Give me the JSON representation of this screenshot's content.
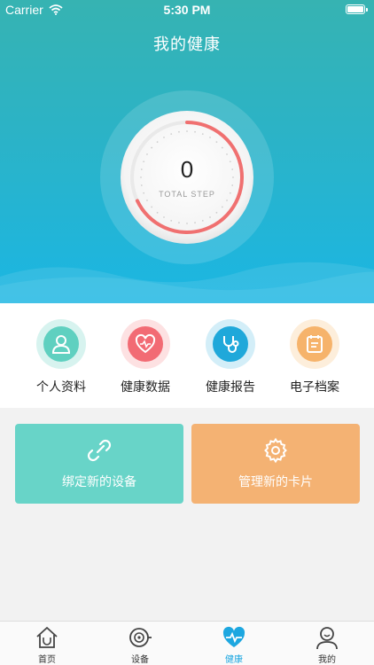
{
  "status_bar": {
    "carrier": "Carrier",
    "time": "5:30 PM"
  },
  "header": {
    "title": "我的健康"
  },
  "step_dial": {
    "value": "0",
    "label": "TOTAL STEP",
    "progress_fraction": 0.68
  },
  "quick_actions": [
    {
      "label": "个人资料",
      "icon": "person-icon",
      "color": "#5fd0c0"
    },
    {
      "label": "健康数据",
      "icon": "heart-data-icon",
      "color": "#f26b74"
    },
    {
      "label": "健康报告",
      "icon": "stethoscope-icon",
      "color": "#1fa8da"
    },
    {
      "label": "电子档案",
      "icon": "file-archive-icon",
      "color": "#f6b36b"
    }
  ],
  "cards": [
    {
      "label": "绑定新的设备",
      "icon": "link-icon",
      "color": "#68d4c8"
    },
    {
      "label": "管理新的卡片",
      "icon": "gear-icon",
      "color": "#f4b273"
    }
  ],
  "tabs": [
    {
      "label": "首页",
      "icon": "home-icon"
    },
    {
      "label": "设备",
      "icon": "device-icon"
    },
    {
      "label": "健康",
      "icon": "heartbeat-icon",
      "active": true
    },
    {
      "label": "我的",
      "icon": "profile-icon"
    }
  ],
  "colors": {
    "accent": "#1da7e0",
    "progress": "#f07070"
  }
}
